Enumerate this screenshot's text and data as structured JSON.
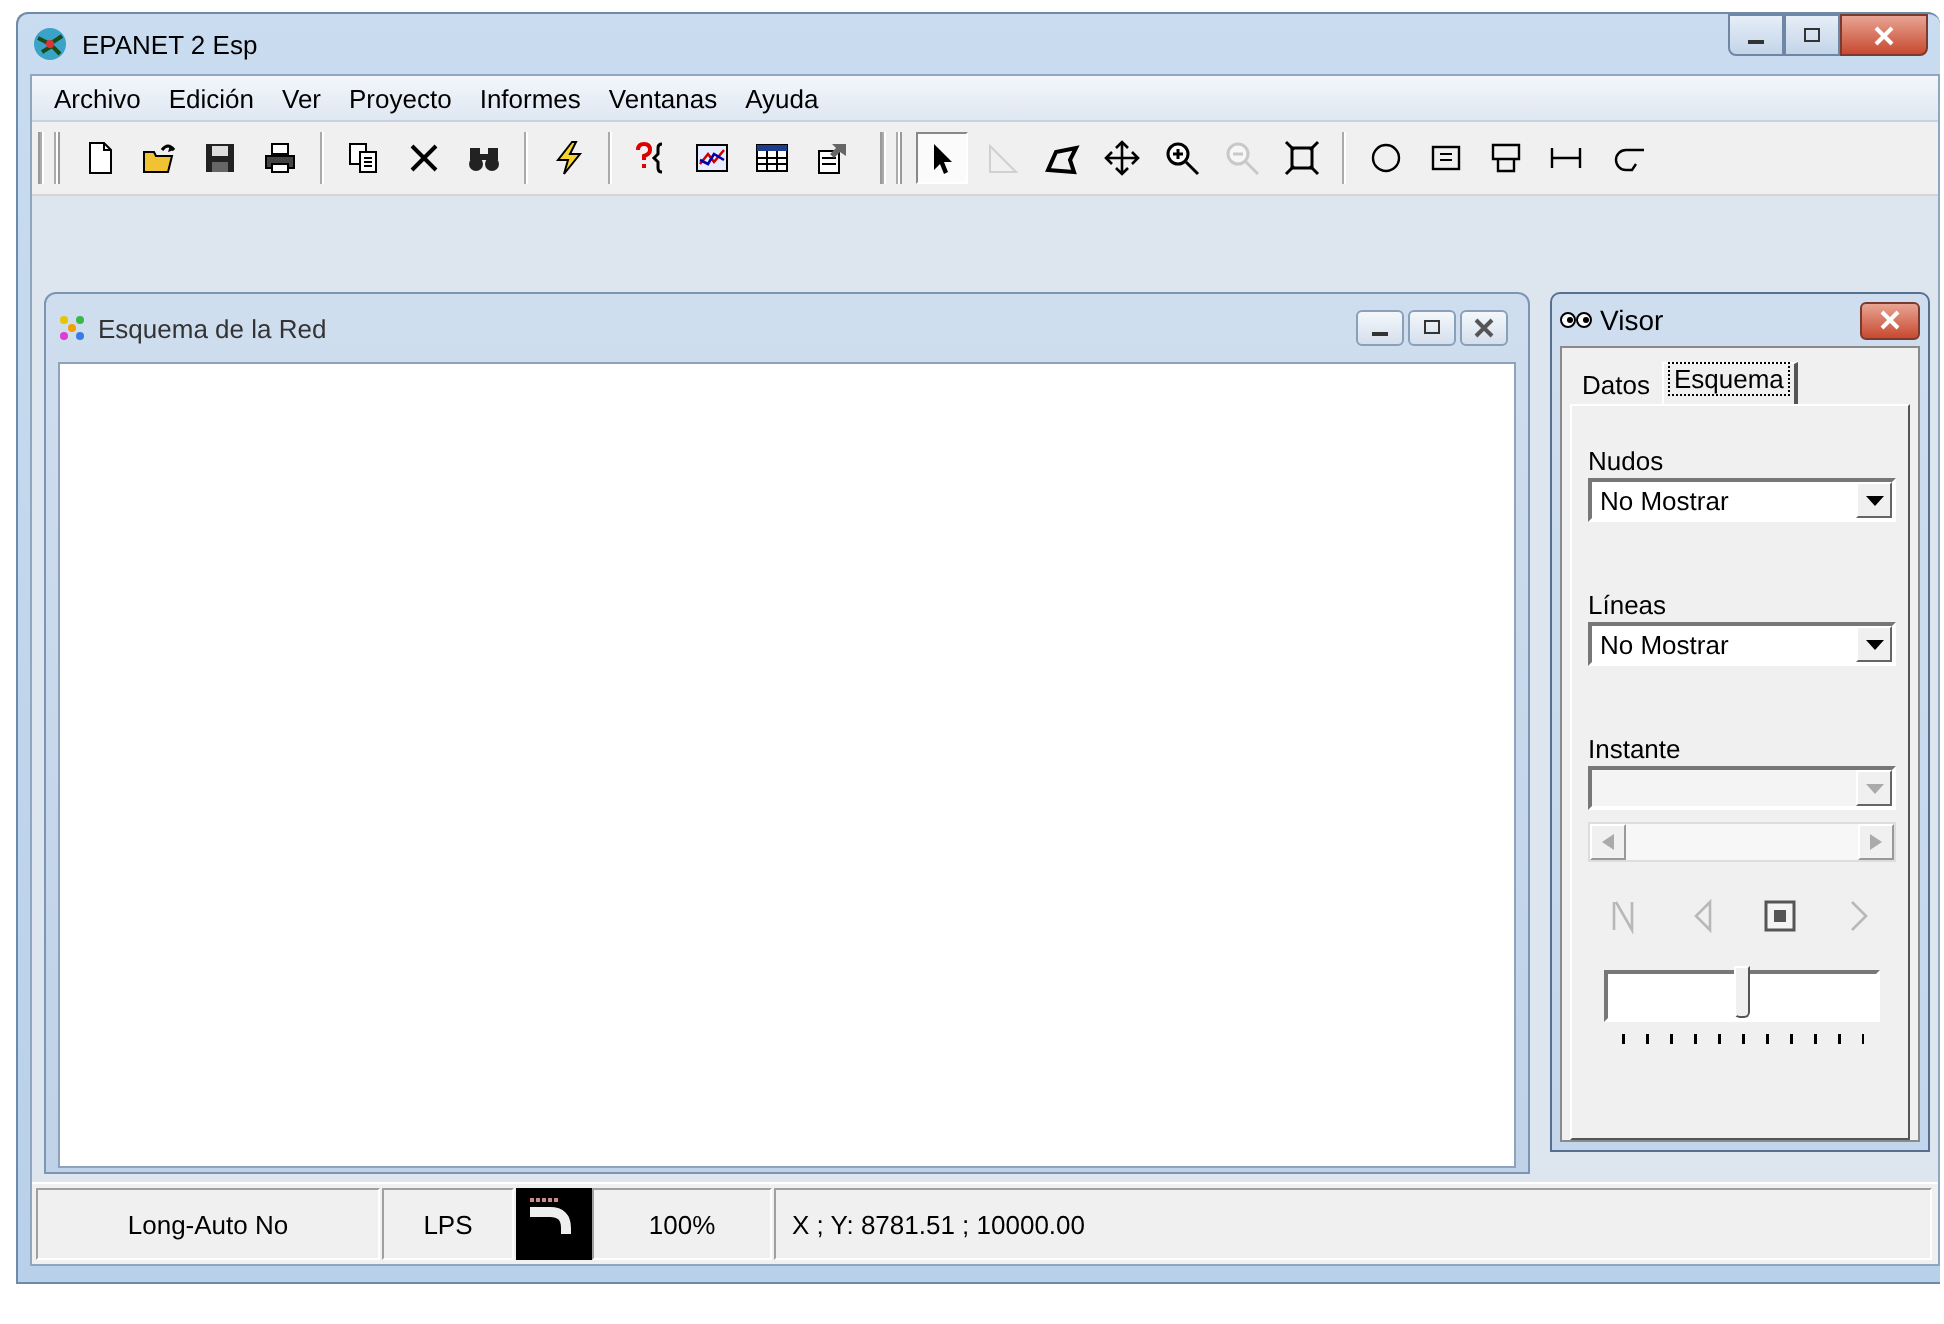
{
  "window": {
    "title": "EPANET 2 Esp"
  },
  "menu": [
    "Archivo",
    "Edición",
    "Ver",
    "Proyecto",
    "Informes",
    "Ventanas",
    "Ayuda"
  ],
  "toolbars": [
    [
      [
        {
          "kind": "new",
          "disabled": false,
          "selected": false
        },
        {
          "kind": "open",
          "disabled": false,
          "selected": false
        },
        {
          "kind": "save",
          "disabled": false,
          "selected": false
        },
        {
          "kind": "print",
          "disabled": false,
          "selected": false
        }
      ],
      [
        {
          "kind": "copy",
          "disabled": false,
          "selected": false
        },
        {
          "kind": "delete",
          "disabled": false,
          "selected": false
        },
        {
          "kind": "find",
          "disabled": false,
          "selected": false
        }
      ],
      [
        {
          "kind": "run",
          "disabled": false,
          "selected": false
        }
      ],
      [
        {
          "kind": "query",
          "disabled": false,
          "selected": false
        },
        {
          "kind": "graph",
          "disabled": false,
          "selected": false
        },
        {
          "kind": "table",
          "disabled": false,
          "selected": false
        },
        {
          "kind": "options",
          "disabled": false,
          "selected": false
        }
      ]
    ],
    [
      [
        {
          "kind": "select",
          "disabled": false,
          "selected": true
        },
        {
          "kind": "vertex",
          "disabled": true,
          "selected": false
        },
        {
          "kind": "polygon",
          "disabled": false,
          "selected": false
        },
        {
          "kind": "pan",
          "disabled": false,
          "selected": false
        },
        {
          "kind": "zoom-in",
          "disabled": false,
          "selected": false
        },
        {
          "kind": "zoom-out",
          "disabled": true,
          "selected": false
        },
        {
          "kind": "full-extent",
          "disabled": false,
          "selected": false
        }
      ],
      [
        {
          "kind": "junction",
          "disabled": false,
          "selected": false
        },
        {
          "kind": "reservoir",
          "disabled": false,
          "selected": false
        },
        {
          "kind": "tank",
          "disabled": false,
          "selected": false
        },
        {
          "kind": "pipe",
          "disabled": false,
          "selected": false
        },
        {
          "kind": "pump",
          "disabled": false,
          "selected": false
        }
      ]
    ]
  ],
  "network_map": {
    "title": "Esquema de la Red"
  },
  "browser": {
    "title": "Visor",
    "tabs": [
      {
        "label": "Datos",
        "selected": false
      },
      {
        "label": "Esquema",
        "selected": true
      }
    ],
    "fields": [
      {
        "label": "Nudos",
        "value": "No Mostrar",
        "disabled": false
      },
      {
        "label": "Líneas",
        "value": "No Mostrar",
        "disabled": false
      },
      {
        "label": "Instante",
        "disabled": true
      }
    ],
    "playback": [
      {
        "kind": "rewind",
        "disabled": true
      },
      {
        "kind": "back",
        "disabled": true
      },
      {
        "kind": "stop",
        "disabled": false
      },
      {
        "kind": "forward",
        "disabled": true
      }
    ],
    "speed": {
      "level": 0.5
    }
  },
  "status_bar": {
    "auto_length": "Long-Auto No",
    "flow_units": "LPS",
    "zoom": "100%",
    "coordinates": "X ; Y: 8781.51 ;  10000.00"
  }
}
